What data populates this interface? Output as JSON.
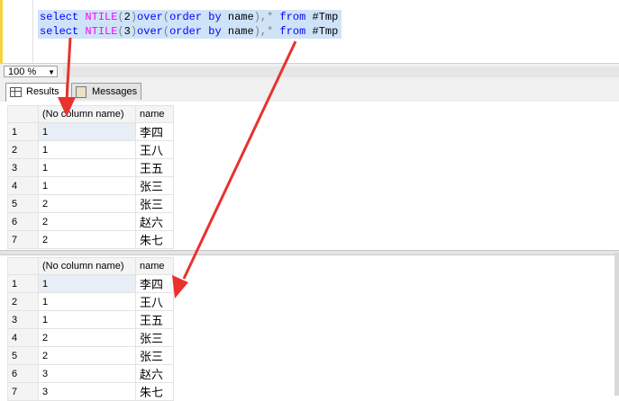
{
  "editor": {
    "line1": {
      "select": "select",
      "fn": "NTILE",
      "open": "(",
      "arg": "2",
      "close": ")",
      "over": "over",
      "p1": "(",
      "orderby": "order by",
      "col": "name",
      "p2": "),",
      "star": "*",
      "from": "from",
      "tbl": "#Tmp"
    },
    "line2": {
      "select": "select",
      "fn": "NTILE",
      "open": "(",
      "arg": "3",
      "close": ")",
      "over": "over",
      "p1": "(",
      "orderby": "order by",
      "col": "name",
      "p2": "),",
      "star": "*",
      "from": "from",
      "tbl": "#Tmp"
    }
  },
  "zoom": {
    "value": "100 %"
  },
  "tabs": [
    {
      "label": "Results"
    },
    {
      "label": "Messages"
    }
  ],
  "grid1": {
    "headers": [
      "(No column name)",
      "name"
    ],
    "rows": [
      [
        "1",
        "1",
        "李四"
      ],
      [
        "2",
        "1",
        "王八"
      ],
      [
        "3",
        "1",
        "王五"
      ],
      [
        "4",
        "1",
        "张三"
      ],
      [
        "5",
        "2",
        "张三"
      ],
      [
        "6",
        "2",
        "赵六"
      ],
      [
        "7",
        "2",
        "朱七"
      ]
    ]
  },
  "grid2": {
    "headers": [
      "(No column name)",
      "name"
    ],
    "rows": [
      [
        "1",
        "1",
        "李四"
      ],
      [
        "2",
        "1",
        "王八"
      ],
      [
        "3",
        "1",
        "王五"
      ],
      [
        "4",
        "2",
        "张三"
      ],
      [
        "5",
        "2",
        "张三"
      ],
      [
        "6",
        "3",
        "赵六"
      ],
      [
        "7",
        "3",
        "朱七"
      ]
    ]
  },
  "colors": {
    "keyword": "#0000ff",
    "function": "#ff00ff",
    "selection": "#cfe3f8",
    "arrow": "#e8322e"
  }
}
